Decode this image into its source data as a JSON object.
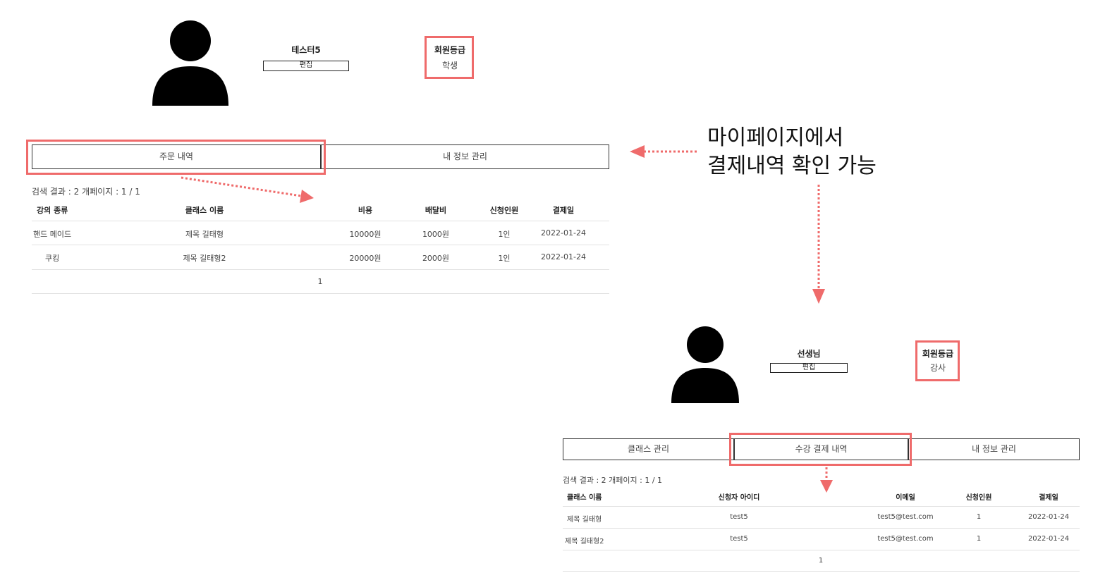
{
  "top": {
    "username": "테스터5",
    "edit_label": "편집",
    "grade_label": "회원등급",
    "grade_value": "학생",
    "tabs": [
      {
        "label": "주문 내역"
      },
      {
        "label": "내 정보 관리"
      }
    ],
    "search_summary": "검색 결과 : 2 개페이지 : 1 / 1",
    "columns": [
      "강의 종류",
      "클래스 이름",
      "비용",
      "배달비",
      "신청인원",
      "결제일"
    ],
    "rows": [
      [
        "핸드 메이드",
        "제목 길태형",
        "10000원",
        "1000원",
        "1인",
        "2022-01-24"
      ],
      [
        "쿠킹",
        "제목 길태형2",
        "20000원",
        "2000원",
        "1인",
        "2022-01-24"
      ]
    ],
    "page_number": "1"
  },
  "annotation": {
    "line1": "마이페이지에서",
    "line2": "결제내역 확인 가능",
    "color": "#ef6b6b"
  },
  "bottom": {
    "username": "선생님",
    "edit_label": "편집",
    "grade_label": "회원등급",
    "grade_value": "강사",
    "tabs": [
      {
        "label": "클래스 관리"
      },
      {
        "label": "수강 결제 내역"
      },
      {
        "label": "내 정보 관리"
      }
    ],
    "search_summary": "검색 결과 : 2 개페이지 : 1 / 1",
    "columns": [
      "클래스 이름",
      "신청자 아이디",
      "이메일",
      "신청인원",
      "결제일"
    ],
    "rows": [
      [
        "제목 길태형",
        "test5",
        "test5@test.com",
        "1",
        "2022-01-24"
      ],
      [
        "제목 길태형2",
        "test5",
        "test5@test.com",
        "1",
        "2022-01-24"
      ]
    ],
    "page_number": "1"
  }
}
